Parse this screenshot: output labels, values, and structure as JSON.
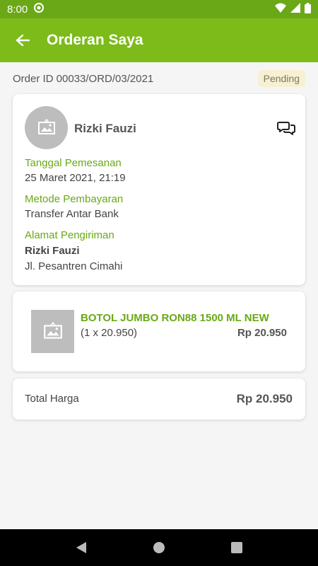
{
  "status_bar": {
    "time": "8:00"
  },
  "app_bar": {
    "title": "Orderan Saya"
  },
  "order": {
    "id_label": "Order ID 00033/ORD/03/2021",
    "status": "Pending"
  },
  "customer": {
    "name": "Rizki Fauzi",
    "order_date_label": "Tanggal Pemesanan",
    "order_date": "25 Maret 2021, 21:19",
    "payment_label": "Metode Pembayaran",
    "payment_method": "Transfer Antar Bank",
    "address_label": "Alamat Pengiriman",
    "recipient_name": "Rizki Fauzi",
    "address": "Jl. Pesantren Cimahi"
  },
  "product": {
    "name": "BOTOL JUMBO RON88 1500 ML NEW",
    "qty_text": "(1 x 20.950)",
    "price": "Rp 20.950"
  },
  "total": {
    "label": "Total Harga",
    "value": "Rp 20.950"
  },
  "colors": {
    "primary": "#7cbb1a",
    "primary_dark": "#6aa817",
    "badge_bg": "#f7f0d3"
  }
}
